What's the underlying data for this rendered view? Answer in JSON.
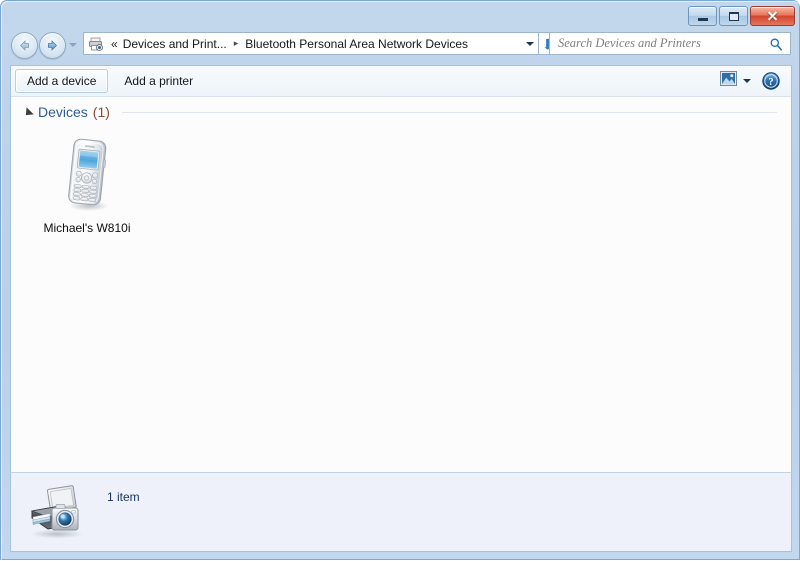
{
  "window": {
    "caption_buttons": {
      "minimize": "Minimize",
      "maximize": "Maximize",
      "close": "Close"
    }
  },
  "navigation": {
    "back_label": "Back",
    "forward_label": "Forward",
    "recent_pages_label": "Recent pages",
    "refresh_label": "Refresh"
  },
  "address_bar": {
    "icon": "devices-and-printers-icon",
    "overflow": "«",
    "separator": "▸",
    "crumbs": [
      "Devices and Print...",
      "Bluetooth Personal Area Network Devices"
    ],
    "dropdown_label": "Previous locations"
  },
  "search": {
    "placeholder": "Search Devices and Printers",
    "value": "",
    "icon": "search-icon"
  },
  "toolbar": {
    "add_device_label": "Add a device",
    "add_printer_label": "Add a printer",
    "view_icon": "preview-pane-icon",
    "view_dropdown_icon": "chevron-down-icon",
    "help_icon": "help-icon"
  },
  "group": {
    "title": "Devices",
    "count": "(1)",
    "collapse_icon": "triangle-collapse-icon"
  },
  "items": [
    {
      "label": "Michael's W810i",
      "icon": "mobile-phone-icon"
    }
  ],
  "status": {
    "icon": "devices-and-printers-icon",
    "text": "1 item"
  },
  "colors": {
    "frame": "#bcd2ea",
    "client_bg": "#fcfcfc",
    "status_bg": "#eef1f9",
    "group_title": "#2d5b92",
    "group_count": "#8a4a38",
    "close_button": "#d2452c",
    "accent_blue": "#1c6fb5"
  }
}
